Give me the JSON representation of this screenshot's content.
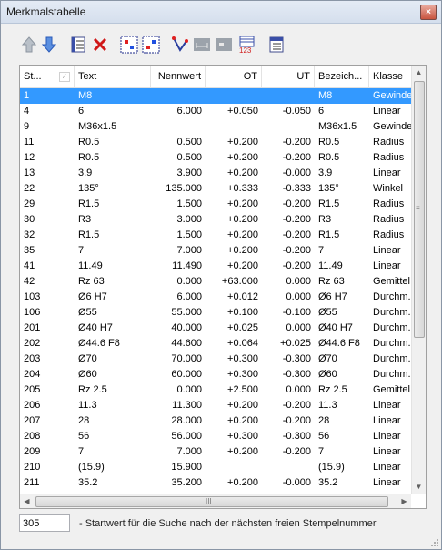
{
  "window": {
    "title": "Merkmalstabelle",
    "close_label": "×"
  },
  "colors": {
    "selection": "#3399ff",
    "arrow_up": "#9aa3ad",
    "arrow_down": "#2f6fd6",
    "delete": "#d01818"
  },
  "toolbar": {
    "icons": [
      "move-up-icon",
      "move-down-icon",
      "properties-icon",
      "delete-icon",
      "select-all-icon",
      "select-row-icon",
      "select-vertex-icon",
      "dimension-disabled-icon",
      "dimension-2-disabled-icon",
      "renumber-icon",
      "table-settings-icon"
    ]
  },
  "table": {
    "headers": {
      "st": "St...",
      "text": "Text",
      "nennwert": "Nennwert",
      "ot": "OT",
      "ut": "UT",
      "bez": "Bezeich...",
      "klasse": "Klasse"
    },
    "sort_icon": "sort-icon",
    "rows": [
      {
        "st": "1",
        "text": "M8",
        "nennwert": "",
        "ot": "",
        "ut": "",
        "bez": "M8",
        "klasse": "Gewinde",
        "selected": true
      },
      {
        "st": "4",
        "text": "6",
        "nennwert": "6.000",
        "ot": "+0.050",
        "ut": "-0.050",
        "bez": "6",
        "klasse": "Linear"
      },
      {
        "st": "9",
        "text": "M36x1.5",
        "nennwert": "",
        "ot": "",
        "ut": "",
        "bez": "M36x1.5",
        "klasse": "Gewinde"
      },
      {
        "st": "11",
        "text": "R0.5",
        "nennwert": "0.500",
        "ot": "+0.200",
        "ut": "-0.200",
        "bez": "R0.5",
        "klasse": "Radius"
      },
      {
        "st": "12",
        "text": "R0.5",
        "nennwert": "0.500",
        "ot": "+0.200",
        "ut": "-0.200",
        "bez": "R0.5",
        "klasse": "Radius"
      },
      {
        "st": "13",
        "text": "3.9",
        "nennwert": "3.900",
        "ot": "+0.200",
        "ut": "-0.000",
        "bez": "3.9",
        "klasse": "Linear"
      },
      {
        "st": "22",
        "text": "135°",
        "nennwert": "135.000",
        "ot": "+0.333",
        "ut": "-0.333",
        "bez": "135°",
        "klasse": "Winkel"
      },
      {
        "st": "29",
        "text": "R1.5",
        "nennwert": "1.500",
        "ot": "+0.200",
        "ut": "-0.200",
        "bez": "R1.5",
        "klasse": "Radius"
      },
      {
        "st": "30",
        "text": "R3",
        "nennwert": "3.000",
        "ot": "+0.200",
        "ut": "-0.200",
        "bez": "R3",
        "klasse": "Radius"
      },
      {
        "st": "32",
        "text": "R1.5",
        "nennwert": "1.500",
        "ot": "+0.200",
        "ut": "-0.200",
        "bez": "R1.5",
        "klasse": "Radius"
      },
      {
        "st": "35",
        "text": "7",
        "nennwert": "7.000",
        "ot": "+0.200",
        "ut": "-0.200",
        "bez": "7",
        "klasse": "Linear"
      },
      {
        "st": "41",
        "text": "11.49",
        "nennwert": "11.490",
        "ot": "+0.200",
        "ut": "-0.200",
        "bez": "11.49",
        "klasse": "Linear"
      },
      {
        "st": "42",
        "text": "Rz 63",
        "nennwert": "0.000",
        "ot": "+63.000",
        "ut": "0.000",
        "bez": "Rz 63",
        "klasse": "Gemittel..."
      },
      {
        "st": "103",
        "text": "Ø6 H7",
        "nennwert": "6.000",
        "ot": "+0.012",
        "ut": "0.000",
        "bez": "Ø6 H7",
        "klasse": "Durchm..."
      },
      {
        "st": "106",
        "text": "Ø55",
        "nennwert": "55.000",
        "ot": "+0.100",
        "ut": "-0.100",
        "bez": "Ø55",
        "klasse": "Durchm..."
      },
      {
        "st": "201",
        "text": "Ø40 H7",
        "nennwert": "40.000",
        "ot": "+0.025",
        "ut": "0.000",
        "bez": "Ø40 H7",
        "klasse": "Durchm..."
      },
      {
        "st": "202",
        "text": "Ø44.6 F8",
        "nennwert": "44.600",
        "ot": "+0.064",
        "ut": "+0.025",
        "bez": "Ø44.6 F8",
        "klasse": "Durchm..."
      },
      {
        "st": "203",
        "text": "Ø70",
        "nennwert": "70.000",
        "ot": "+0.300",
        "ut": "-0.300",
        "bez": "Ø70",
        "klasse": "Durchm..."
      },
      {
        "st": "204",
        "text": "Ø60",
        "nennwert": "60.000",
        "ot": "+0.300",
        "ut": "-0.300",
        "bez": "Ø60",
        "klasse": "Durchm..."
      },
      {
        "st": "205",
        "text": "Rz 2.5",
        "nennwert": "0.000",
        "ot": "+2.500",
        "ut": "0.000",
        "bez": "Rz 2.5",
        "klasse": "Gemittel..."
      },
      {
        "st": "206",
        "text": "11.3",
        "nennwert": "11.300",
        "ot": "+0.200",
        "ut": "-0.200",
        "bez": "11.3",
        "klasse": "Linear"
      },
      {
        "st": "207",
        "text": "28",
        "nennwert": "28.000",
        "ot": "+0.200",
        "ut": "-0.200",
        "bez": "28",
        "klasse": "Linear"
      },
      {
        "st": "208",
        "text": "56",
        "nennwert": "56.000",
        "ot": "+0.300",
        "ut": "-0.300",
        "bez": "56",
        "klasse": "Linear"
      },
      {
        "st": "209",
        "text": "7",
        "nennwert": "7.000",
        "ot": "+0.200",
        "ut": "-0.200",
        "bez": "7",
        "klasse": "Linear"
      },
      {
        "st": "210",
        "text": "(15.9)",
        "nennwert": "15.900",
        "ot": "",
        "ut": "",
        "bez": "(15.9)",
        "klasse": "Linear"
      },
      {
        "st": "211",
        "text": "35.2",
        "nennwert": "35.200",
        "ot": "+0.200",
        "ut": "-0.000",
        "bez": "35.2",
        "klasse": "Linear"
      }
    ]
  },
  "scrollbars": {
    "vgrip": "≡",
    "hgrip": "III"
  },
  "footer": {
    "start_value": "305",
    "hint": "- Startwert für die Suche nach der nächsten freien Stempelnummer"
  }
}
